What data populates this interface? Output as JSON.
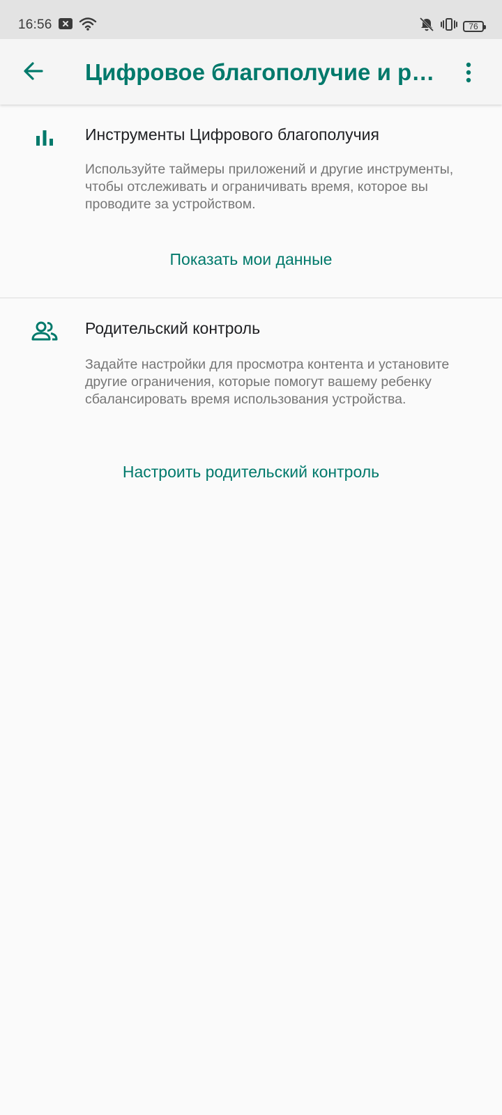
{
  "status_bar": {
    "time": "16:56",
    "battery": "76",
    "icons": [
      "notification-x-icon",
      "wifi-icon",
      "vibrate-mute-icon",
      "vibrate-icon",
      "battery-icon"
    ]
  },
  "app_bar": {
    "title": "Цифровое благополучие и родительский контроль",
    "back_icon": "arrow-back-icon",
    "more_icon": "more-vert-icon"
  },
  "sections": [
    {
      "icon": "bar-chart-icon",
      "title": "Инструменты Цифрового благополучия",
      "description": "Используйте таймеры приложений и другие инструменты, чтобы отслеживать и ограничивать время, которое вы проводите за устройством.",
      "link": "Показать мои данные"
    },
    {
      "icon": "people-icon",
      "title": "Родительский контроль",
      "description": "Задайте настройки для просмотра контента и установите другие ограничения, которые помогут вашему ребенку сбалансировать время использования устройства.",
      "link": "Настроить родительский контроль"
    }
  ],
  "colors": {
    "accent": "#00796b",
    "background": "#fafafa",
    "status_bar": "#e3e3e3"
  }
}
